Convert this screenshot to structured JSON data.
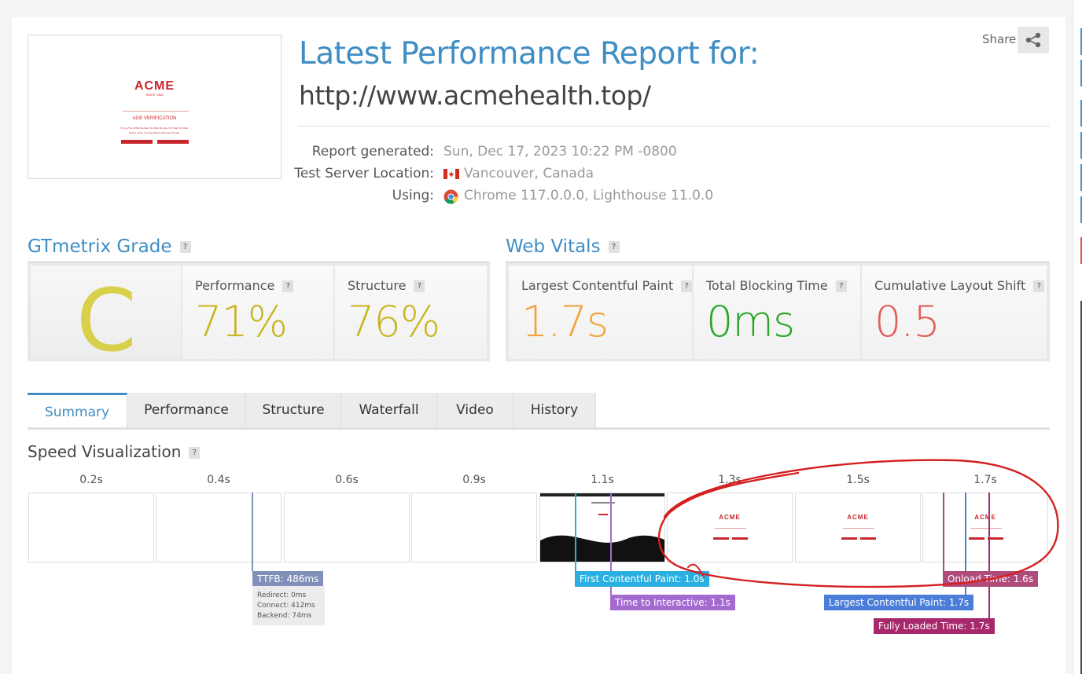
{
  "header": {
    "title": "Latest Performance Report for:",
    "url": "http://www.acmehealth.top/",
    "share_label": "Share"
  },
  "thumbnail": {
    "logo": "ACME",
    "tagline": "SINCE 1965",
    "heading": "AGE VERIFICATION",
    "line1": "To Use The ACME Website You Must Be Aged 18 Years Or Older.",
    "line2": "Please Verify Your Age Before Entering The Site."
  },
  "meta": {
    "report_label": "Report generated:",
    "report_value": "Sun, Dec 17, 2023 10:22 PM -0800",
    "location_label": "Test Server Location:",
    "location_value": "Vancouver, Canada",
    "using_label": "Using:",
    "using_value": "Chrome 117.0.0.0, Lighthouse 11.0.0"
  },
  "grade": {
    "title": "GTmetrix Grade",
    "letter": "C",
    "performance_label": "Performance",
    "performance_value": "71%",
    "structure_label": "Structure",
    "structure_value": "76%"
  },
  "vitals": {
    "title": "Web Vitals",
    "lcp_label": "Largest Contentful Paint",
    "lcp_value": "1.7s",
    "tbt_label": "Total Blocking Time",
    "tbt_value": "0ms",
    "cls_label": "Cumulative Layout Shift",
    "cls_value": "0.5"
  },
  "tabs": [
    "Summary",
    "Performance",
    "Structure",
    "Waterfall",
    "Video",
    "History"
  ],
  "speed": {
    "title": "Speed Visualization",
    "times": [
      "0.2s",
      "0.4s",
      "0.6s",
      "0.9s",
      "1.1s",
      "1.3s",
      "1.5s",
      "1.7s"
    ]
  },
  "markers": {
    "ttfb": "TTFB: 486ms",
    "redirect": "Redirect: 0ms",
    "connect": "Connect: 412ms",
    "backend": "Backend: 74ms",
    "fcp": "First Contentful Paint: 1.0s",
    "tti": "Time to Interactive: 1.1s",
    "lcp": "Largest Contentful Paint: 1.7s",
    "onload": "Onload Time: 1.6s",
    "fully_loaded": "Fully Loaded Time: 1.7s"
  },
  "colors": {
    "accent": "#3e8dc5",
    "grade_c": "#d8cf4a",
    "performance": "#c9b51e",
    "lcp": "#f0a33a",
    "tbt": "#2aa52a",
    "cls": "#e0605a",
    "ttfb": "#8190b8",
    "fcp": "#29b0e0",
    "tti": "#a46ad0",
    "lcp_marker": "#4a7ed8",
    "onload": "#b04c7c",
    "fully_loaded": "#a8286c",
    "annotation": "#d42020"
  }
}
